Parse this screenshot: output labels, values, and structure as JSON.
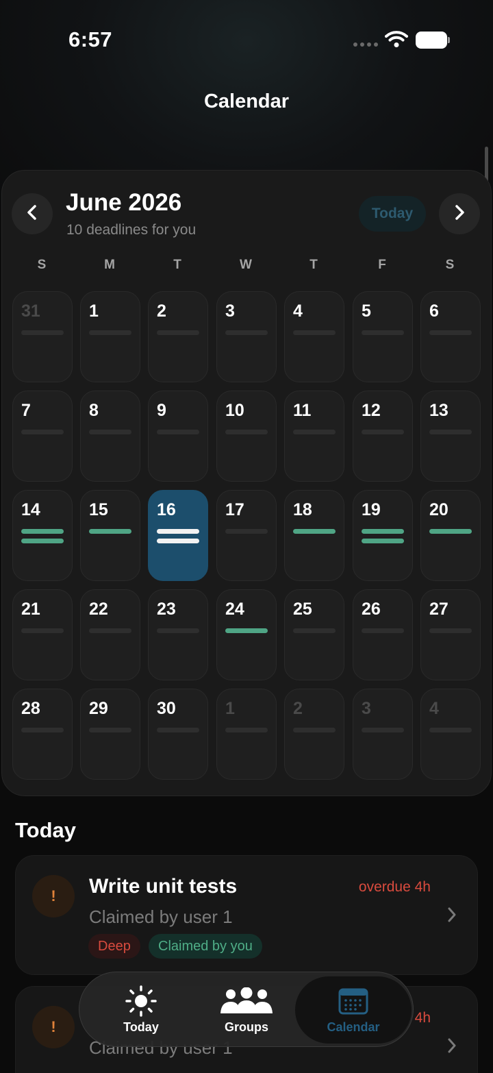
{
  "status_bar": {
    "time": "6:57",
    "signal_icon": "cellular-dots-icon",
    "wifi_icon": "wifi-icon",
    "battery_icon": "battery-icon"
  },
  "header": {
    "title": "Calendar"
  },
  "calendar": {
    "month_title": "June 2026",
    "subtitle": "10 deadlines for you",
    "today_button": "Today",
    "prev_icon": "chevron-left-icon",
    "next_icon": "chevron-right-icon",
    "weekdays": [
      "S",
      "M",
      "T",
      "W",
      "T",
      "F",
      "S"
    ],
    "days": [
      {
        "label": "31",
        "muted": true,
        "selected": false,
        "deadlines": 0
      },
      {
        "label": "1",
        "muted": false,
        "selected": false,
        "deadlines": 0
      },
      {
        "label": "2",
        "muted": false,
        "selected": false,
        "deadlines": 0
      },
      {
        "label": "3",
        "muted": false,
        "selected": false,
        "deadlines": 0
      },
      {
        "label": "4",
        "muted": false,
        "selected": false,
        "deadlines": 0
      },
      {
        "label": "5",
        "muted": false,
        "selected": false,
        "deadlines": 0
      },
      {
        "label": "6",
        "muted": false,
        "selected": false,
        "deadlines": 0
      },
      {
        "label": "7",
        "muted": false,
        "selected": false,
        "deadlines": 0
      },
      {
        "label": "8",
        "muted": false,
        "selected": false,
        "deadlines": 0
      },
      {
        "label": "9",
        "muted": false,
        "selected": false,
        "deadlines": 0
      },
      {
        "label": "10",
        "muted": false,
        "selected": false,
        "deadlines": 0
      },
      {
        "label": "11",
        "muted": false,
        "selected": false,
        "deadlines": 0
      },
      {
        "label": "12",
        "muted": false,
        "selected": false,
        "deadlines": 0
      },
      {
        "label": "13",
        "muted": false,
        "selected": false,
        "deadlines": 0
      },
      {
        "label": "14",
        "muted": false,
        "selected": false,
        "deadlines": 2
      },
      {
        "label": "15",
        "muted": false,
        "selected": false,
        "deadlines": 1
      },
      {
        "label": "16",
        "muted": false,
        "selected": true,
        "deadlines": 2
      },
      {
        "label": "17",
        "muted": false,
        "selected": false,
        "deadlines": 0
      },
      {
        "label": "18",
        "muted": false,
        "selected": false,
        "deadlines": 1
      },
      {
        "label": "19",
        "muted": false,
        "selected": false,
        "deadlines": 2
      },
      {
        "label": "20",
        "muted": false,
        "selected": false,
        "deadlines": 1
      },
      {
        "label": "21",
        "muted": false,
        "selected": false,
        "deadlines": 0
      },
      {
        "label": "22",
        "muted": false,
        "selected": false,
        "deadlines": 0
      },
      {
        "label": "23",
        "muted": false,
        "selected": false,
        "deadlines": 0
      },
      {
        "label": "24",
        "muted": false,
        "selected": false,
        "deadlines": 1
      },
      {
        "label": "25",
        "muted": false,
        "selected": false,
        "deadlines": 0
      },
      {
        "label": "26",
        "muted": false,
        "selected": false,
        "deadlines": 0
      },
      {
        "label": "27",
        "muted": false,
        "selected": false,
        "deadlines": 0
      },
      {
        "label": "28",
        "muted": false,
        "selected": false,
        "deadlines": 0
      },
      {
        "label": "29",
        "muted": false,
        "selected": false,
        "deadlines": 0
      },
      {
        "label": "30",
        "muted": false,
        "selected": false,
        "deadlines": 0
      },
      {
        "label": "1",
        "muted": true,
        "selected": false,
        "deadlines": 0
      },
      {
        "label": "2",
        "muted": true,
        "selected": false,
        "deadlines": 0
      },
      {
        "label": "3",
        "muted": true,
        "selected": false,
        "deadlines": 0
      },
      {
        "label": "4",
        "muted": true,
        "selected": false,
        "deadlines": 0
      }
    ]
  },
  "today_section": {
    "title": "Today",
    "tasks": [
      {
        "priority_icon": "!",
        "title": "Write unit tests",
        "due": "overdue 4h",
        "subtitle": "Claimed by user 1",
        "tags": [
          "Deep",
          "Claimed by you"
        ]
      },
      {
        "priority_icon": "!",
        "due": "4h",
        "subtitle": "Claimed by user 1"
      }
    ]
  },
  "tab_bar": {
    "tabs": [
      {
        "label": "Today",
        "icon": "sun-icon",
        "active": false
      },
      {
        "label": "Groups",
        "icon": "people-icon",
        "active": false
      },
      {
        "label": "Calendar",
        "icon": "calendar-icon",
        "active": true
      }
    ]
  },
  "colors": {
    "accent": "#1c4e6c",
    "deadline_bar": "#4fa585",
    "overdue": "#d94b3e",
    "active_tab": "#245f83"
  }
}
